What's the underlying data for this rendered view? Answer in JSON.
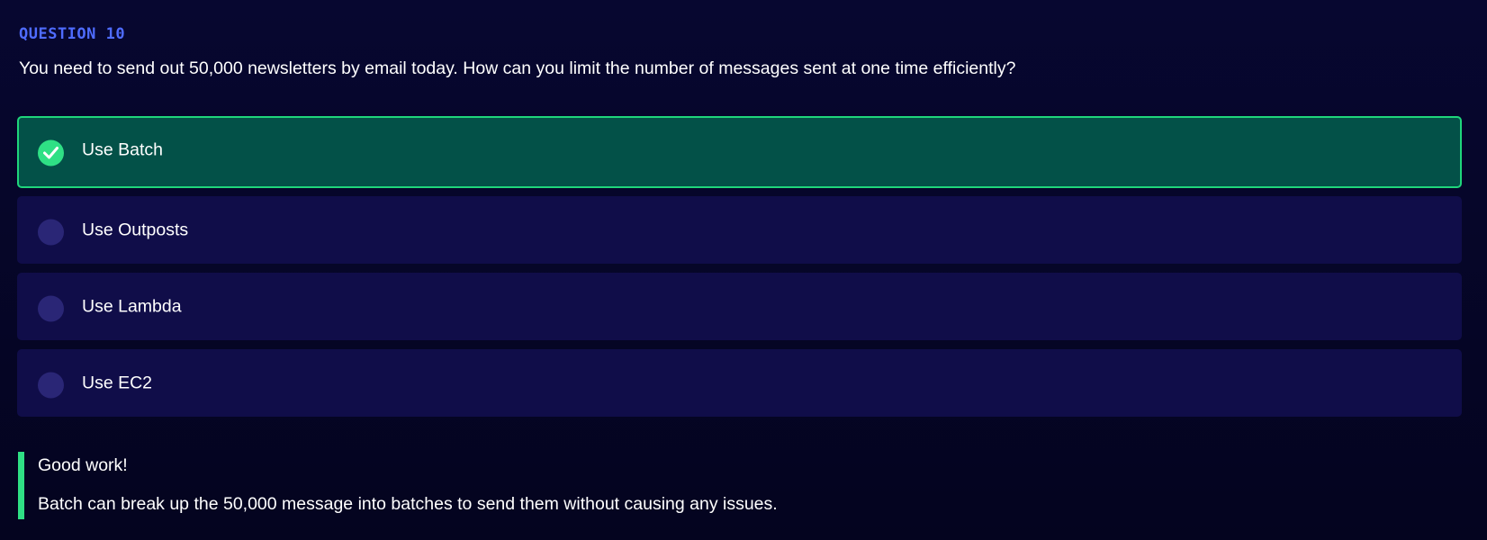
{
  "question": {
    "label": "QUESTION 10",
    "text": "You need to send out 50,000 newsletters by email today. How can you limit the number of messages sent at one time efficiently?"
  },
  "options": [
    {
      "label": "Use Batch",
      "state": "correct",
      "icon": "check-icon"
    },
    {
      "label": "Use Outposts",
      "state": "unselected",
      "icon": "radio-empty-icon"
    },
    {
      "label": "Use Lambda",
      "state": "unselected",
      "icon": "radio-empty-icon"
    },
    {
      "label": "Use EC2",
      "state": "unselected",
      "icon": "radio-empty-icon"
    }
  ],
  "feedback": {
    "title": "Good work!",
    "text": "Batch can break up the 50,000 message into batches to send them without causing any issues."
  },
  "colors": {
    "background": "#05052a",
    "accent_label": "#4f6cff",
    "option_bg": "#100d49",
    "correct_bg": "#035148",
    "correct_border": "#1fd67b",
    "success": "#2fe085"
  }
}
